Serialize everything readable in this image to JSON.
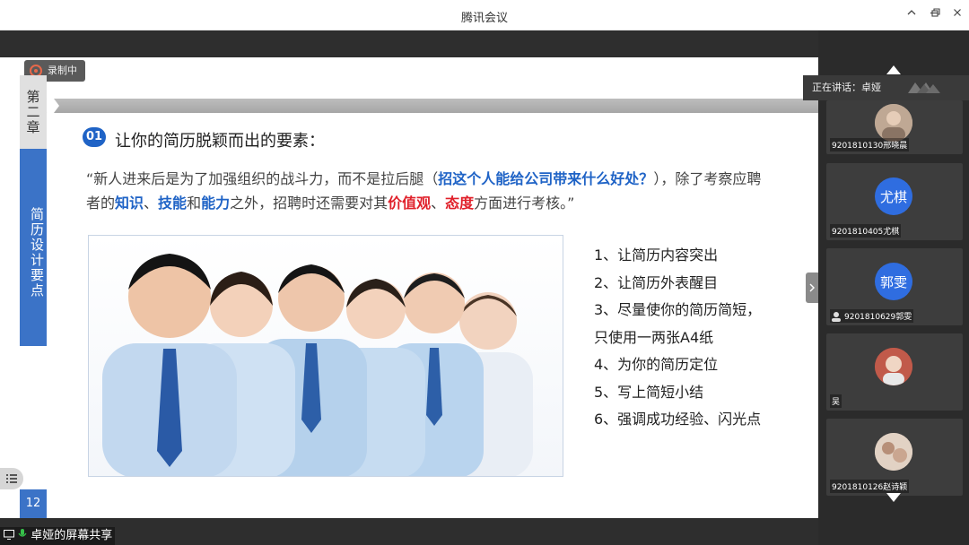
{
  "window": {
    "title": "腾讯会议"
  },
  "recording": {
    "label": "录制中"
  },
  "slide": {
    "chapter_tab": "第二章",
    "section_tab": "简历设计要点",
    "page_number": "12",
    "heading_number": "01",
    "heading": "让你的简历脱颖而出的要素：",
    "quote": {
      "p1": "“新人进来后是为了加强组织的战斗力，而不是拉后腿（",
      "h1": "招这个人能给公司带来什么好处？",
      "p2": "），除了考察应聘者的",
      "h2": "知识",
      "p3": "、",
      "h3": "技能",
      "p4": "和",
      "h4": "能力",
      "p5": "之外，招聘时还需要对其",
      "h5": "价值观",
      "p6": "、",
      "h6": "态度",
      "p7": "方面进行考核。”"
    },
    "points": [
      "1、让简历内容突出",
      "2、让简历外表醒目",
      "3、尽量使你的简历简短，",
      "只使用一两张A4纸",
      "4、为你的简历定位",
      "5、写上简短小结",
      "6、强调成功经验、闪光点"
    ]
  },
  "share": {
    "label": "卓娅的屏幕共享"
  },
  "panel": {
    "speaking": "正在讲话：卓娅",
    "participants": [
      {
        "name": "9201810130邢晓晨",
        "avatar_text": ""
      },
      {
        "name": "9201810405尤棋",
        "avatar_text": "尤棋"
      },
      {
        "name": "9201810629郭雯",
        "avatar_text": "郭雯"
      },
      {
        "name": "吴",
        "avatar_text": ""
      },
      {
        "name": "9201810126赵诗颖",
        "avatar_text": ""
      }
    ]
  },
  "colors": {
    "accent_blue": "#1f63c6",
    "highlight_red": "#e0202a",
    "avatar_blue": "#2f6de0"
  }
}
